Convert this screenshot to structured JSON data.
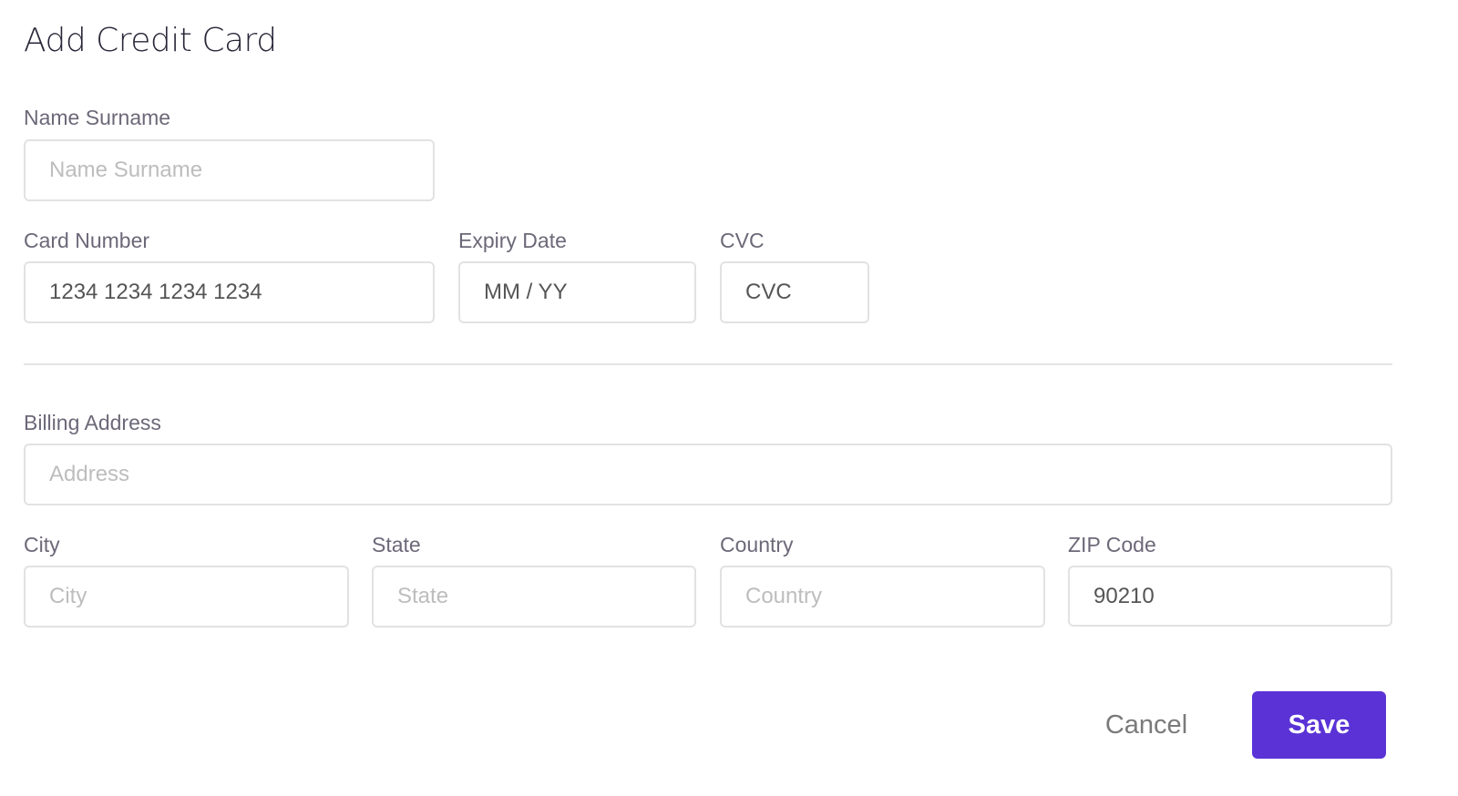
{
  "title": "Add Credit Card",
  "name": {
    "label": "Name Surname",
    "placeholder": "Name Surname",
    "value": ""
  },
  "card": {
    "label": "Card Number",
    "value": "1234 1234 1234 1234"
  },
  "expiry": {
    "label": "Expiry Date",
    "value": "MM / YY"
  },
  "cvc": {
    "label": "CVC",
    "value": "CVC"
  },
  "billing": {
    "label": "Billing Address",
    "placeholder": "Address"
  },
  "city": {
    "label": "City",
    "placeholder": "City"
  },
  "state": {
    "label": "State",
    "placeholder": "State"
  },
  "country": {
    "label": "Country",
    "placeholder": "Country"
  },
  "zip": {
    "label": "ZIP Code",
    "value": "90210"
  },
  "actions": {
    "cancel": "Cancel",
    "save": "Save"
  },
  "colors": {
    "accent": "#5a32d6"
  }
}
